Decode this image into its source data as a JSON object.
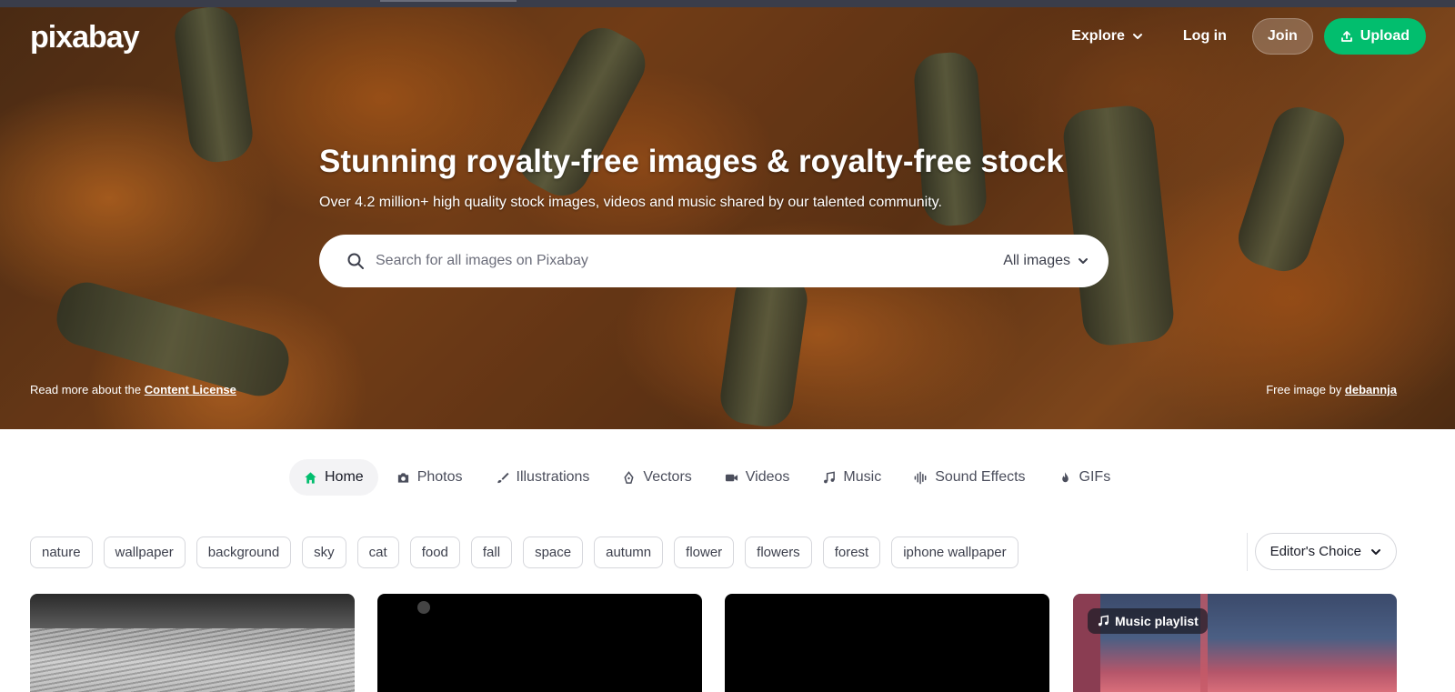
{
  "header": {
    "logo": "pixabay",
    "nav": {
      "explore": "Explore",
      "login": "Log in",
      "join": "Join",
      "upload": "Upload"
    }
  },
  "hero": {
    "title": "Stunning royalty-free images & royalty-free stock",
    "subtitle": "Over 4.2 million+ high quality stock images, videos and music shared by our talented community.",
    "search": {
      "placeholder": "Search for all images on Pixabay",
      "type": "All images"
    },
    "credit_left": {
      "prefix": "Read more about the",
      "link": "Content License"
    },
    "credit_right": {
      "prefix": "Free image by",
      "link": "debannja"
    }
  },
  "tabs": [
    {
      "label": "Home",
      "icon": "home-icon",
      "active": true
    },
    {
      "label": "Photos",
      "icon": "camera-icon"
    },
    {
      "label": "Illustrations",
      "icon": "brush-icon"
    },
    {
      "label": "Vectors",
      "icon": "pen-nib-icon"
    },
    {
      "label": "Videos",
      "icon": "video-camera-icon"
    },
    {
      "label": "Music",
      "icon": "music-note-icon"
    },
    {
      "label": "Sound Effects",
      "icon": "sound-wave-icon"
    },
    {
      "label": "GIFs",
      "icon": "flame-icon"
    }
  ],
  "tags": [
    "nature",
    "wallpaper",
    "background",
    "sky",
    "cat",
    "food",
    "fall",
    "space",
    "autumn",
    "flower",
    "flowers",
    "forest",
    "iphone wallpaper"
  ],
  "sort": {
    "label": "Editor's Choice"
  },
  "cards": {
    "playlist_badge": "Music playlist"
  },
  "colors": {
    "brand_green": "#02be6e",
    "text_dark": "#191b26"
  }
}
